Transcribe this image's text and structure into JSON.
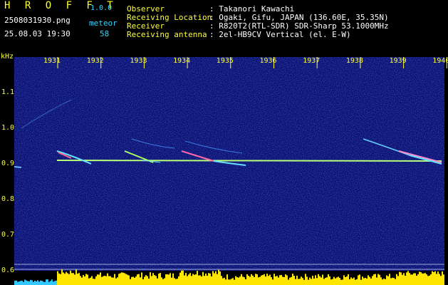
{
  "app": {
    "title": "H R O F F T",
    "version": "1.0.0",
    "filename": "2508031930.png",
    "datetime": "25.08.03 19:30",
    "meteor_label": "meteor",
    "meteor_count": "58"
  },
  "info": {
    "rows": [
      {
        "key": "Observer",
        "value": ": Takanori Kawachi"
      },
      {
        "key": "Receiving Location",
        "value": ": Ogaki, Gifu, JAPAN (136.60E, 35.35N)"
      },
      {
        "key": "Receiver",
        "value": ": R820T2(RTL-SDR) SDR-Sharp 53.1000MHz"
      },
      {
        "key": "Receiving antenna",
        "value": ": 2el-HB9CV Vertical (el. E-W)"
      }
    ]
  },
  "axis": {
    "unit": "kHz",
    "time_ticks": [
      "1931",
      "1932",
      "1933",
      "1934",
      "1935",
      "1936",
      "1937",
      "1938",
      "1939",
      "1940"
    ],
    "freq_ticks": [
      "1.1",
      "1.0",
      "0.9",
      "0.8",
      "0.7",
      "0.6"
    ],
    "freq_ticks_lower": [
      "1.1",
      "1.0",
      "0.9",
      "0.8",
      "0.7",
      "0.6"
    ]
  },
  "colors": {
    "background": "#000000",
    "spectrum_bg": "#0a0f6e",
    "label_yellow": "#ffff33",
    "label_cyan": "#33d6ff",
    "carrier": "#b8ff7a",
    "meteor_echo": "#66e0ff"
  }
}
